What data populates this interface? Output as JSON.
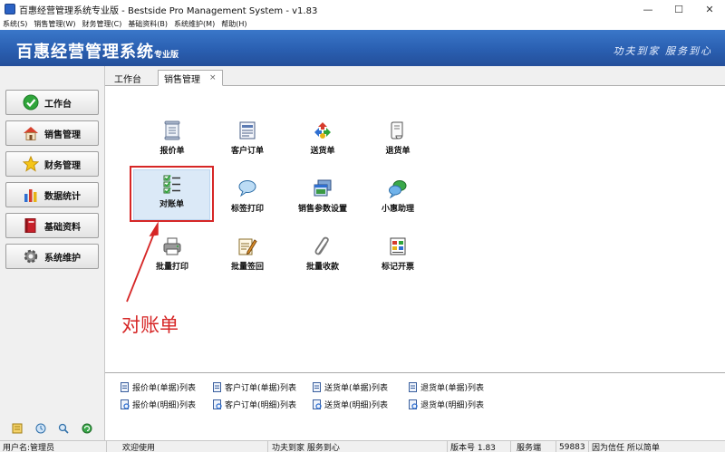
{
  "window": {
    "title": "百惠经营管理系统专业版 - Bestside Pro Management System - v1.83",
    "minimize": "—",
    "maximize": "☐",
    "close": "✕"
  },
  "menu": [
    "系统(S)",
    "销售管理(W)",
    "财务管理(C)",
    "基础资料(B)",
    "系统维护(M)",
    "帮助(H)"
  ],
  "banner": {
    "title": "百惠经营管理系统",
    "subtitle": "专业版",
    "slogan": "功夫到家 服务到心"
  },
  "sidebar": [
    {
      "label": "工作台",
      "icon": "check-circle-icon"
    },
    {
      "label": "销售管理",
      "icon": "house-icon"
    },
    {
      "label": "财务管理",
      "icon": "star-icon"
    },
    {
      "label": "数据统计",
      "icon": "bar-chart-icon"
    },
    {
      "label": "基础资料",
      "icon": "book-icon"
    },
    {
      "label": "系统维护",
      "icon": "gear-icon"
    }
  ],
  "tabs": [
    {
      "label": "工作台",
      "active": false
    },
    {
      "label": "销售管理",
      "active": true,
      "close": "×"
    }
  ],
  "tiles": [
    {
      "label": "报价单",
      "icon": "scroll-icon"
    },
    {
      "label": "客户订单",
      "icon": "order-form-icon"
    },
    {
      "label": "送货单",
      "icon": "recycle-arrows-icon"
    },
    {
      "label": "退货单",
      "icon": "curled-paper-icon"
    },
    {
      "label": "对账单",
      "icon": "checklist-icon",
      "selected": true
    },
    {
      "label": "标签打印",
      "icon": "speech-bubble-icon"
    },
    {
      "label": "销售参数设置",
      "icon": "window-stack-icon"
    },
    {
      "label": "小惠助理",
      "icon": "chat-bubbles-icon"
    },
    {
      "label": "批量打印",
      "icon": "printer-icon"
    },
    {
      "label": "批量签回",
      "icon": "pen-paper-icon"
    },
    {
      "label": "批量收款",
      "icon": "paperclip-icon"
    },
    {
      "label": "标记开票",
      "icon": "invoice-grid-icon"
    }
  ],
  "annotation": "对账单",
  "list_links": [
    "报价单(单据)列表",
    "客户订单(单据)列表",
    "送货单(单据)列表",
    "退货单(单据)列表",
    "报价单(明细)列表",
    "客户订单(明细)列表",
    "送货单(明细)列表",
    "退货单(明细)列表"
  ],
  "status": {
    "user": "用户名:管理员",
    "welcome": "欢迎使用",
    "motto": "功夫到家 服务到心",
    "version": "版本号 1.83",
    "server_label": "服务端",
    "port": "59883",
    "trust": "因为信任 所以简单"
  },
  "colors": {
    "banner": "#2a5fb1",
    "annotation": "#d62626",
    "selected_tile": "#dbe9f7"
  }
}
